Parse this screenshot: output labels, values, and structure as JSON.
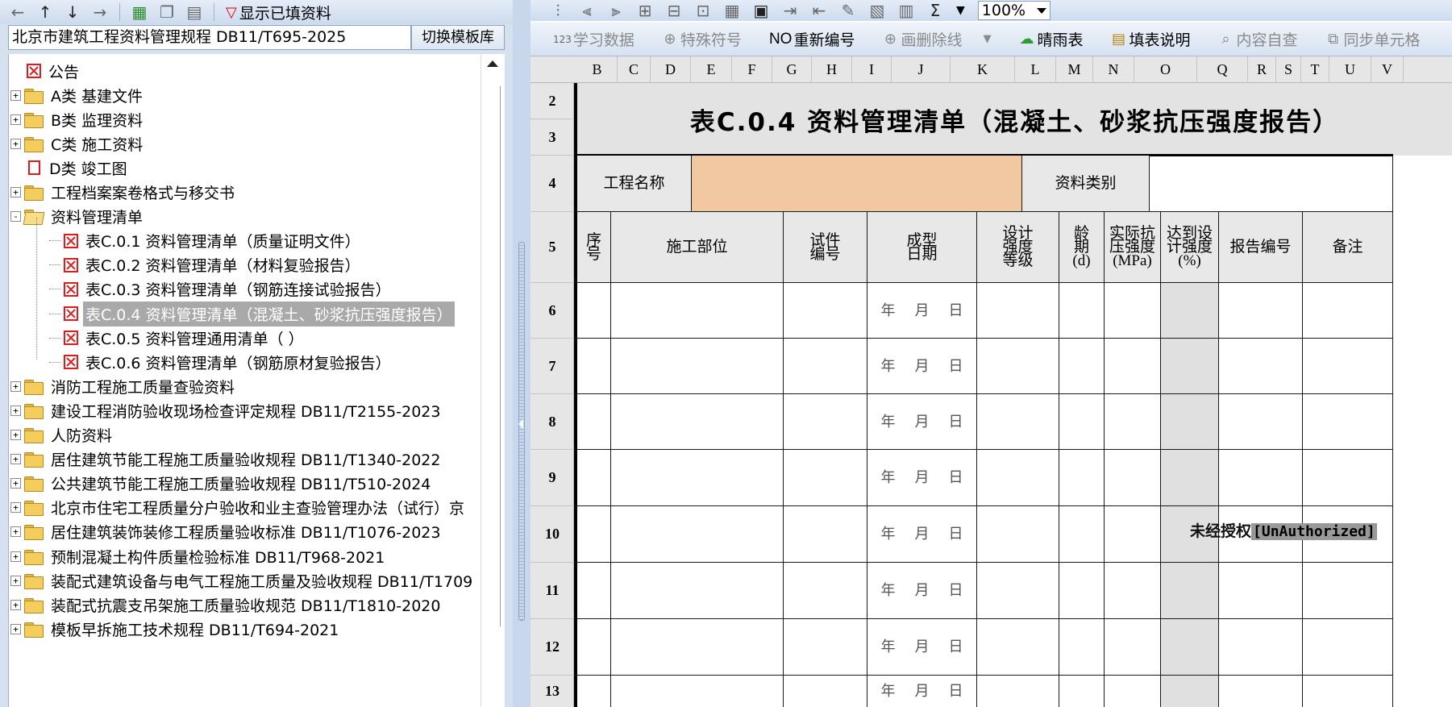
{
  "left_toolbar": {
    "show_filled_label": "显示已填资料"
  },
  "template": {
    "current": "北京市建筑工程资料管理规程 DB11/T695-2025",
    "switch_label": "切换模板库"
  },
  "tree": {
    "items": [
      {
        "label": "公告",
        "icon": "red-x-doc-icon",
        "level": 1,
        "toggle": ""
      },
      {
        "label": "A类 基建文件",
        "icon": "folder-icon",
        "level": 0,
        "toggle": "+"
      },
      {
        "label": "B类 监理资料",
        "icon": "folder-icon",
        "level": 0,
        "toggle": "+"
      },
      {
        "label": "C类 施工资料",
        "icon": "folder-icon",
        "level": 0,
        "toggle": "+"
      },
      {
        "label": "D类 竣工图",
        "icon": "red-doc-icon",
        "level": 1,
        "toggle": ""
      },
      {
        "label": "工程档案案卷格式与移交书",
        "icon": "folder-icon",
        "level": 0,
        "toggle": "+"
      },
      {
        "label": "资料管理清单",
        "icon": "folder-open-icon",
        "level": 0,
        "toggle": "-"
      },
      {
        "label": "表C.0.1 资料管理清单（质量证明文件）",
        "icon": "red-x-doc-icon",
        "level": 2,
        "toggle": ""
      },
      {
        "label": "表C.0.2 资料管理清单（材料复验报告）",
        "icon": "red-x-doc-icon",
        "level": 2,
        "toggle": ""
      },
      {
        "label": "表C.0.3 资料管理清单（钢筋连接试验报告）",
        "icon": "red-x-doc-icon",
        "level": 2,
        "toggle": ""
      },
      {
        "label": "表C.0.4 资料管理清单（混凝土、砂浆抗压强度报告）",
        "icon": "red-x-doc-icon",
        "level": 2,
        "toggle": "",
        "selected": true
      },
      {
        "label": "表C.0.5 资料管理通用清单（ ）",
        "icon": "red-x-doc-icon",
        "level": 2,
        "toggle": ""
      },
      {
        "label": "表C.0.6 资料管理清单（钢筋原材复验报告）",
        "icon": "red-x-doc-icon",
        "level": 2,
        "toggle": ""
      },
      {
        "label": "消防工程施工质量查验资料",
        "icon": "folder-icon",
        "level": 0,
        "toggle": "+"
      },
      {
        "label": "建设工程消防验收现场检查评定规程 DB11/T2155-2023",
        "icon": "folder-icon",
        "level": 0,
        "toggle": "+"
      },
      {
        "label": "人防资料",
        "icon": "folder-icon",
        "level": 0,
        "toggle": "+"
      },
      {
        "label": "居住建筑节能工程施工质量验收规程 DB11/T1340-2022",
        "icon": "folder-icon",
        "level": 0,
        "toggle": "+"
      },
      {
        "label": "公共建筑节能工程施工质量验收规程 DB11/T510-2024",
        "icon": "folder-icon",
        "level": 0,
        "toggle": "+"
      },
      {
        "label": "北京市住宅工程质量分户验收和业主查验管理办法（试行）京",
        "icon": "folder-icon",
        "level": 0,
        "toggle": "+"
      },
      {
        "label": "居住建筑装饰装修工程质量验收标准 DB11/T1076-2023",
        "icon": "folder-icon",
        "level": 0,
        "toggle": "+"
      },
      {
        "label": "预制混凝土构件质量检验标准 DB11/T968-2021",
        "icon": "folder-icon",
        "level": 0,
        "toggle": "+"
      },
      {
        "label": "装配式建筑设备与电气工程施工质量及验收规程 DB11/T1709",
        "icon": "folder-icon",
        "level": 0,
        "toggle": "+"
      },
      {
        "label": "装配式抗震支吊架施工质量验收规范 DB11/T1810-2020",
        "icon": "folder-icon",
        "level": 0,
        "toggle": "+"
      },
      {
        "label": "模板早拆施工技术规程 DB11/T694-2021",
        "icon": "folder-icon",
        "level": 0,
        "toggle": "+"
      }
    ]
  },
  "right_toolbar1": {
    "sum_symbol": "Σ",
    "zoom": "100%"
  },
  "right_toolbar2": {
    "learn_data": "学习数据",
    "learn_prefix": "123",
    "special_symbol": "特殊符号",
    "renumber_prefix": "NO",
    "renumber": "重新编号",
    "strike": "画删除线",
    "weather": "晴雨表",
    "fill_help": "填表说明",
    "self_check": "内容自查",
    "sync_cells": "同步单元格"
  },
  "sheet": {
    "columns": [
      "B",
      "C",
      "D",
      "E",
      "F",
      "G",
      "H",
      "I",
      "J",
      "K",
      "L",
      "M",
      "N",
      "O",
      "Q",
      "R",
      "S",
      "T",
      "U",
      "V"
    ],
    "rows": [
      "2",
      "3",
      "4",
      "5",
      "6",
      "7",
      "8",
      "9",
      "10",
      "11",
      "12",
      "13"
    ],
    "title": "表C.0.4 资料管理清单（混凝土、砂浆抗压强度报告）",
    "project_name_label": "工程名称",
    "category_label": "资料类别",
    "headers": {
      "seq": "序\n号",
      "location": "施工部位",
      "specimen_no": "试件\n编号",
      "cast_date": "成型\n日期",
      "design_grade": "设计\n强度\n等级",
      "age": "龄\n期\n(d)",
      "actual_strength": "实际抗\n压强度\n(MPa)",
      "reach_design": "达到设\n计强度\n(%)",
      "report_no": "报告编号",
      "remark": "备注"
    },
    "date_year": "年",
    "date_month": "月",
    "date_day": "日"
  },
  "watermark": {
    "cn": "未经授权",
    "en": "[UnAuthorized]"
  },
  "colors": {
    "project_name_fill": "#f2c8a2",
    "selected_fill": "#a9a9a9",
    "toolbar_bg": "#d6e1f0"
  }
}
